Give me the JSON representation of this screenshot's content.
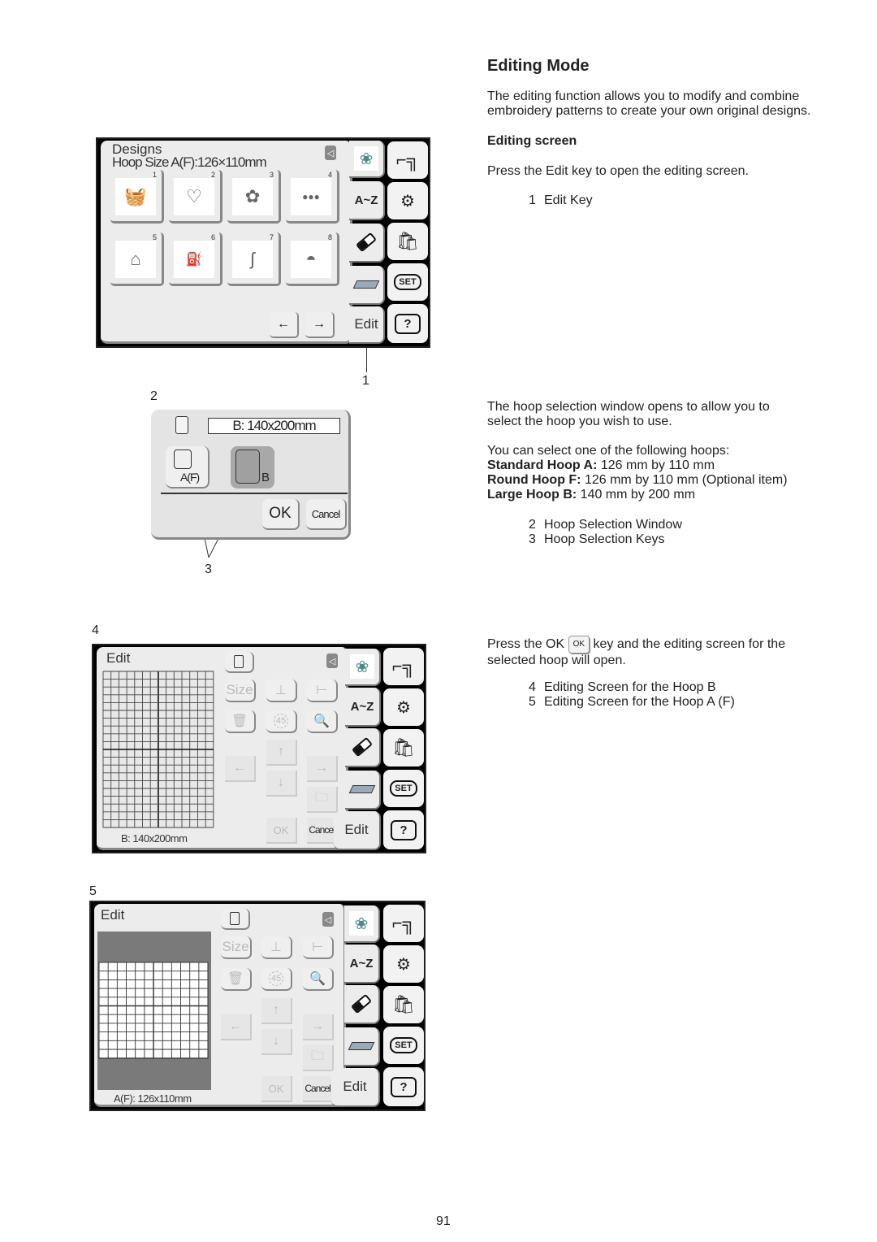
{
  "page": {
    "title": "Editing Mode",
    "intro": [
      "The editing function allows you to modify and combine",
      "embroidery patterns to create your own original designs."
    ],
    "section_title": "Editing screen",
    "edit_instruction": "Press the Edit key to open the editing screen.",
    "legend1": [
      {
        "num": "1",
        "label": "Edit Key"
      }
    ],
    "hoop_intro": [
      "The hoop selection window opens to allow you to",
      "select the hoop you wish to use."
    ],
    "hoop_list_intro": "You can select one of the following hoops:",
    "hoops": [
      {
        "name": "Standard Hoop A:",
        "size": " 126 mm by 110 mm"
      },
      {
        "name": "Round Hoop F:",
        "size": " 126 mm by 110 mm (Optional item)"
      },
      {
        "name": "Large Hoop B:",
        "size": " 140 mm by 200 mm"
      }
    ],
    "legend2": [
      {
        "num": "2",
        "label": "Hoop Selection Window"
      },
      {
        "num": "3",
        "label": "Hoop Selection Keys"
      }
    ],
    "ok_text_before": "Press the OK ",
    "ok_key": "OK",
    "ok_text_after": " key and the editing screen for the",
    "ok_text_line2": "selected hoop will open.",
    "legend3": [
      {
        "num": "4",
        "label": "Editing Screen for the Hoop B"
      },
      {
        "num": "5",
        "label": "Editing Screen for the Hoop A (F)"
      }
    ],
    "page_number": "91",
    "callouts": {
      "c1": "1",
      "c2": "2",
      "c3": "3",
      "c4": "4",
      "c5": "5"
    }
  },
  "designs_screen": {
    "title": "Designs",
    "hoop_size": "Hoop Size A(F):126×110mm",
    "thumbnails": [
      {
        "num": "1",
        "icon": "basket"
      },
      {
        "num": "2",
        "icon": "heart"
      },
      {
        "num": "3",
        "icon": "flowerpot"
      },
      {
        "num": "4",
        "icon": "berries"
      },
      {
        "num": "5",
        "icon": "house"
      },
      {
        "num": "6",
        "icon": "watering-can"
      },
      {
        "num": "7",
        "icon": "brush"
      },
      {
        "num": "8",
        "icon": "hat"
      }
    ],
    "prev_label": "←",
    "next_label": "→"
  },
  "tabs": {
    "az": "A~Z",
    "edit": "Edit"
  },
  "side_buttons": {
    "set": "SET",
    "help": "?"
  },
  "hoop_window": {
    "display": "B: 140x200mm",
    "key_a": "A(F)",
    "key_b": "B",
    "ok": "OK",
    "cancel": "Cancel"
  },
  "edit_screen_b": {
    "title": "Edit",
    "status": "B: 140x200mm",
    "size": "Size",
    "rotate": "45",
    "ok": "OK",
    "cancel": "Cancel"
  },
  "edit_screen_a": {
    "title": "Edit",
    "status": "A(F): 126x110mm",
    "size": "Size",
    "rotate": "45",
    "ok": "OK",
    "cancel": "Cancel"
  }
}
